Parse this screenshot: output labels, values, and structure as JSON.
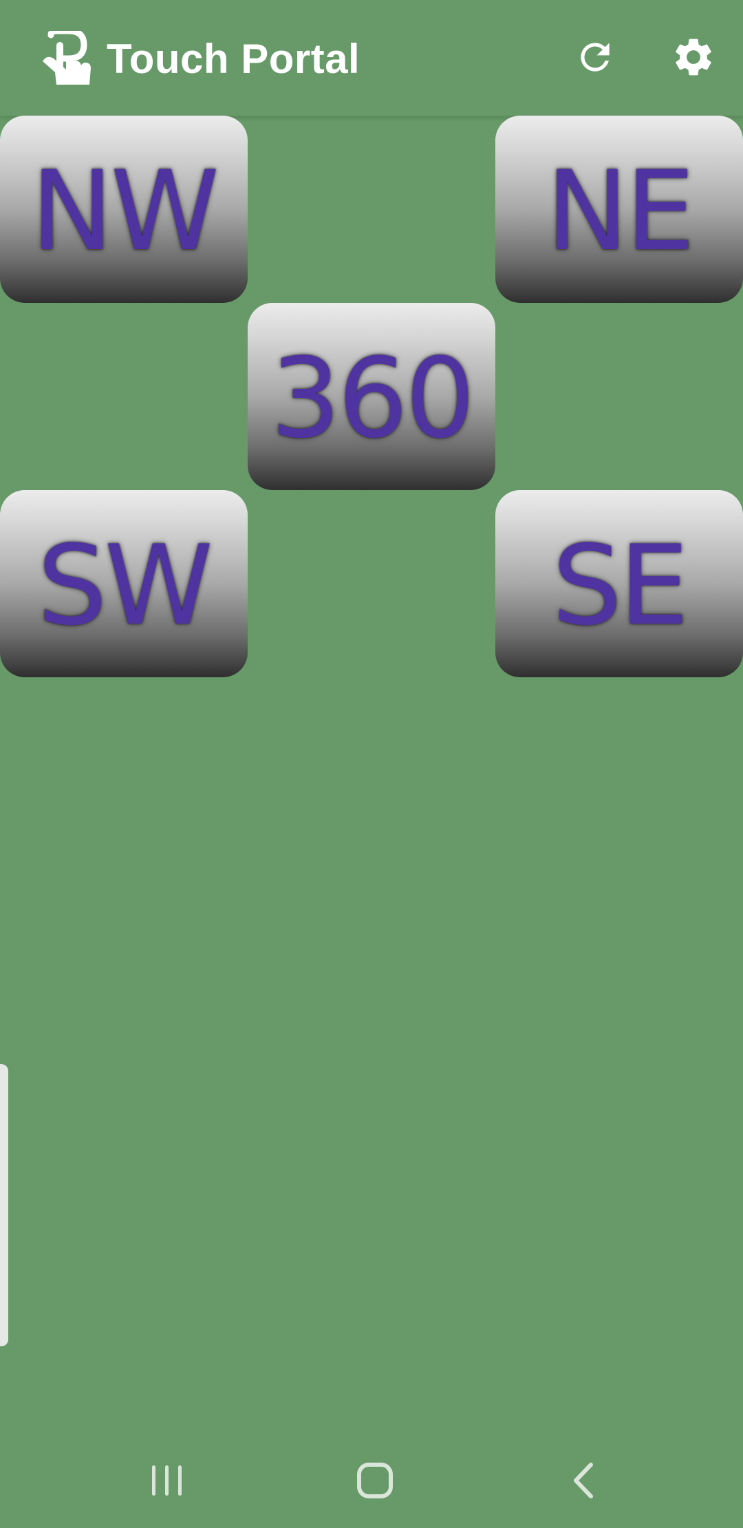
{
  "app": {
    "title": "Touch Portal"
  },
  "toolbar": {
    "refresh_icon": "refresh-icon",
    "settings_icon": "gear-icon"
  },
  "tiles": [
    {
      "id": "nw",
      "label": "NW"
    },
    {
      "id": "ne",
      "label": "NE"
    },
    {
      "id": "center",
      "label": "360"
    },
    {
      "id": "sw",
      "label": "SW"
    },
    {
      "id": "se",
      "label": "SE"
    }
  ],
  "colors": {
    "background": "#679a68",
    "tile_text": "#4f34a1",
    "toolbar_icons": "#ffffff",
    "nav_icons": "#d9e6d9"
  },
  "system_nav": {
    "recent_icon": "recent-apps-icon",
    "home_icon": "home-icon",
    "back_icon": "back-icon"
  }
}
